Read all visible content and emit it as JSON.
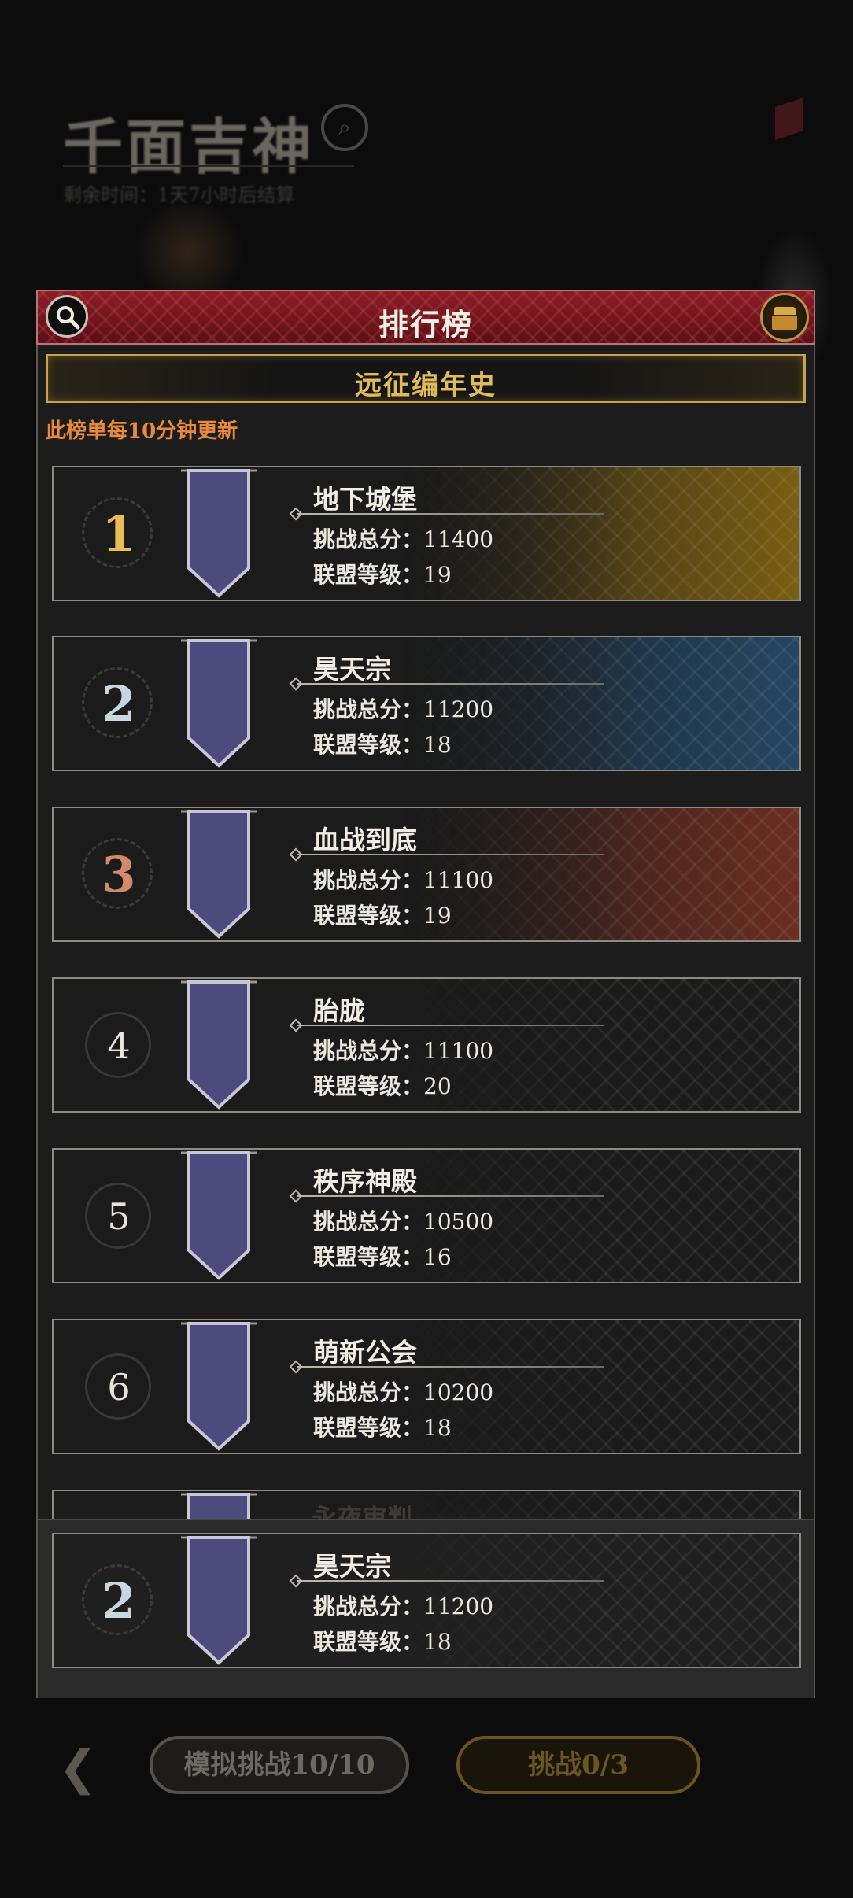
{
  "background": {
    "title": "千面吉神",
    "subtitle": "剩余时间：1天7小时后结算"
  },
  "header": {
    "title": "排行榜"
  },
  "tab": {
    "label": "远征编年史"
  },
  "note": "此榜单每10分钟更新",
  "stat_labels": {
    "score": "挑战总分：",
    "level": "联盟等级："
  },
  "rows": [
    {
      "rank": "1",
      "name": "地下城堡",
      "score": "11400",
      "level": "19"
    },
    {
      "rank": "2",
      "name": "昊天宗",
      "score": "11200",
      "level": "18"
    },
    {
      "rank": "3",
      "name": "血战到底",
      "score": "11100",
      "level": "19"
    },
    {
      "rank": "4",
      "name": "胎胧",
      "score": "11100",
      "level": "20"
    },
    {
      "rank": "5",
      "name": "秩序神殿",
      "score": "10500",
      "level": "16"
    },
    {
      "rank": "6",
      "name": "萌新公会",
      "score": "10200",
      "level": "18"
    }
  ],
  "partial_row_name": "永夜审判",
  "my_guild": {
    "rank": "2",
    "name": "昊天宗",
    "score": "11200",
    "level": "18"
  },
  "buttons": {
    "simulate": "模拟挑战10/10",
    "challenge": "挑战0/3"
  },
  "colors": {
    "header_red": "#8c1d26",
    "gold_accent": "#e0bb5a",
    "note_orange": "#e98a3b"
  }
}
